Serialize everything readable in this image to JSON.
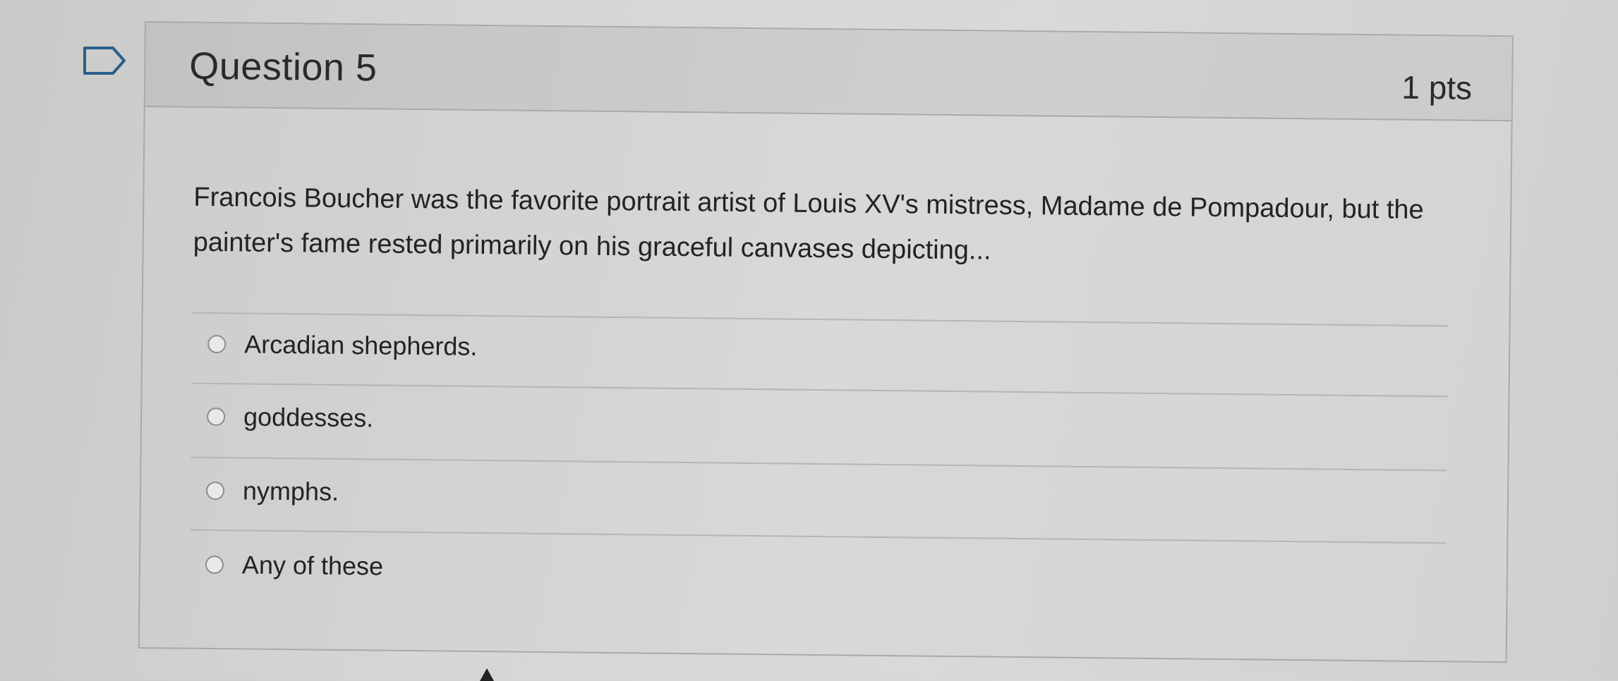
{
  "question": {
    "title": "Question 5",
    "points": "1 pts",
    "text": "Francois Boucher was the favorite portrait artist of Louis XV's mistress, Madame de Pompadour, but the painter's fame rested primarily on his graceful canvases depicting...",
    "flag_icon": "flag-question-icon"
  },
  "answers": [
    {
      "label": "Arcadian shepherds.",
      "selected": false
    },
    {
      "label": "goddesses.",
      "selected": false
    },
    {
      "label": "nymphs.",
      "selected": false
    },
    {
      "label": "Any of these",
      "selected": false
    }
  ],
  "colors": {
    "background": "#d6d6d4",
    "border": "#a9a9a7",
    "text": "#232323"
  }
}
